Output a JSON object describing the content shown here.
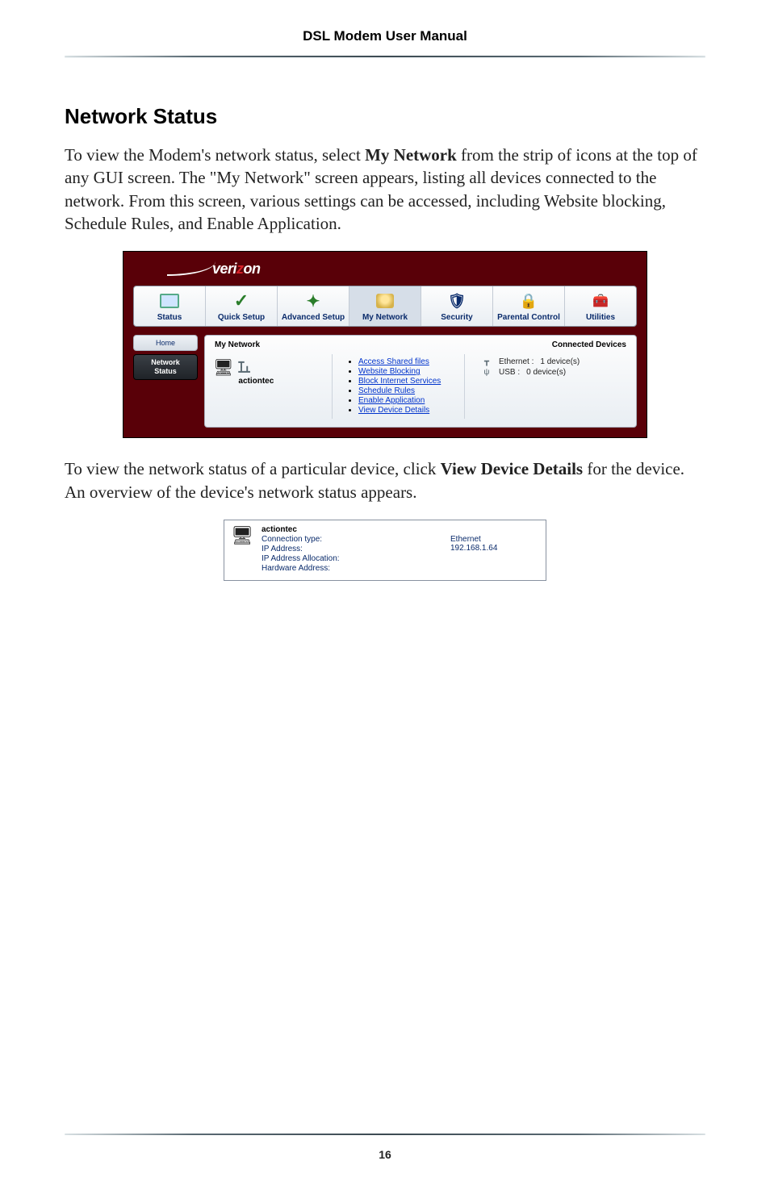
{
  "header": {
    "title": "DSL Modem User Manual"
  },
  "section": {
    "heading": "Network Status"
  },
  "para1": {
    "pre": "To view the Modem's network status, select ",
    "bold": "My Network",
    "post": " from the strip of icons at the top of any GUI screen. The \"My Network\" screen appears, listing all devices connected to the network. From this screen, various settings can be accessed, including Website blocking, Schedule Rules, and Enable Application."
  },
  "para2": {
    "pre": "To view the network status of a particular device, click ",
    "bold": "View Device Details",
    "post": " for the device. An overview of the device's network status appears."
  },
  "gui": {
    "brand_prefix": "veri",
    "brand_mid": "z",
    "brand_suffix": "on",
    "tabs": [
      {
        "label": "Status"
      },
      {
        "label": "Quick Setup"
      },
      {
        "label": "Advanced Setup"
      },
      {
        "label": "My Network"
      },
      {
        "label": "Security"
      },
      {
        "label": "Parental Control"
      },
      {
        "label": "Utilities"
      }
    ],
    "side": {
      "home": "Home",
      "net1": "Network",
      "net2": "Status"
    },
    "panel_head_left": "My Network",
    "panel_head_right": "Connected Devices",
    "device_name": "actiontec",
    "links": [
      "Access Shared files",
      "Website Blocking",
      "Block Internet Services",
      "Schedule Rules",
      "Enable Application",
      "View Device Details"
    ],
    "conn": {
      "eth_label": "Ethernet :",
      "eth_val": "1 device(s)",
      "usb_label": "USB :",
      "usb_val": "0 device(s)"
    }
  },
  "detail": {
    "name": "actiontec",
    "rows": [
      {
        "label": "Connection type:",
        "value": "Ethernet"
      },
      {
        "label": "IP Address:",
        "value": "192.168.1.64"
      },
      {
        "label": "IP Address Allocation:",
        "value": ""
      },
      {
        "label": "Hardware Address:",
        "value": ""
      }
    ]
  },
  "footer": {
    "page": "16"
  }
}
